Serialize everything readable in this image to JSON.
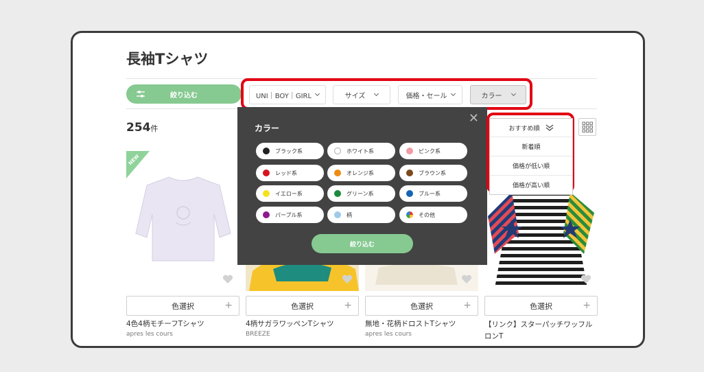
{
  "page": {
    "title": "長袖Tシャツ"
  },
  "toolbar": {
    "filter_label": "絞り込む",
    "dropdowns": [
      "UNI｜BOY｜GIRL",
      "サイズ",
      "価格・セール",
      "カラー"
    ]
  },
  "results": {
    "count": "254",
    "unit": "件"
  },
  "color_panel": {
    "title": "カラー",
    "close": "✕",
    "apply": "絞り込む",
    "colors": [
      {
        "label": "ブラック系",
        "color": "#222222"
      },
      {
        "label": "ホワイト系",
        "color": "#ffffff"
      },
      {
        "label": "ピンク系",
        "color": "#f29aa6"
      },
      {
        "label": "レッド系",
        "color": "#d7141e"
      },
      {
        "label": "オレンジ系",
        "color": "#ef8b13"
      },
      {
        "label": "ブラウン系",
        "color": "#7b4a1c"
      },
      {
        "label": "イエロー系",
        "color": "#f5e21c"
      },
      {
        "label": "グリーン系",
        "color": "#1a8a3b"
      },
      {
        "label": "ブルー系",
        "color": "#1565b6"
      },
      {
        "label": "パープル系",
        "color": "#8c1a8e"
      },
      {
        "label": "柄",
        "color": "#9fcbe9"
      },
      {
        "label": "その他",
        "color": "conic"
      }
    ]
  },
  "sort": {
    "current": "おすすめ順",
    "options": [
      "新着順",
      "価格が低い順",
      "価格が高い順"
    ]
  },
  "badge": {
    "new": "NEW"
  },
  "products": [
    {
      "color_button": "色選択",
      "name": "4色4柄モチーフTシャツ",
      "brand": "apres les cours"
    },
    {
      "color_button": "色選択",
      "name": "4柄サガラワッペンTシャツ",
      "brand": "BREEZE"
    },
    {
      "color_button": "色選択",
      "name": "無地・花柄ドロストTシャツ",
      "brand": "apres les cours"
    },
    {
      "color_button": "色選択",
      "name": "【リンク】スターパッチワッフルロンT",
      "brand": ""
    }
  ],
  "accent_colors": {
    "green": "#86c991",
    "highlight": "#e10012",
    "panel": "#434343"
  }
}
